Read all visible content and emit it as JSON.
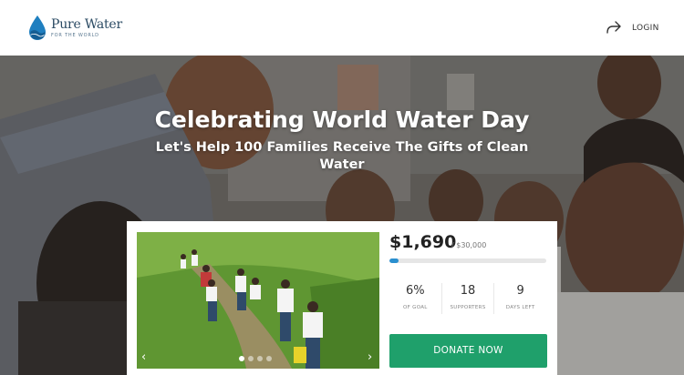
{
  "header": {
    "logo_name": "Pure Water",
    "logo_tag": "FOR THE WORLD",
    "share_icon": "share-arrow-icon",
    "login_label": "LOGIN"
  },
  "hero": {
    "title": "Celebrating World Water Day",
    "subtitle": "Let's Help 100 Families Receive The Gifts of Clean Water"
  },
  "campaign": {
    "raised": "$1,690",
    "goal": "/ $30,000",
    "progress_fraction": 0.06,
    "stats": [
      {
        "value": "6%",
        "label": "OF GOAL"
      },
      {
        "value": "18",
        "label": "SUPPORTERS"
      },
      {
        "value": "9",
        "label": "DAYS LEFT"
      }
    ],
    "donate_label": "DONATE NOW",
    "slider": {
      "prev_icon": "chevron-left-icon",
      "next_icon": "chevron-right-icon",
      "slide_count": 4,
      "active_slide": 1
    }
  },
  "colors": {
    "brand": "#2a4a63",
    "accent_blue": "#2a8fcf",
    "donate_green": "#1fa06b"
  }
}
